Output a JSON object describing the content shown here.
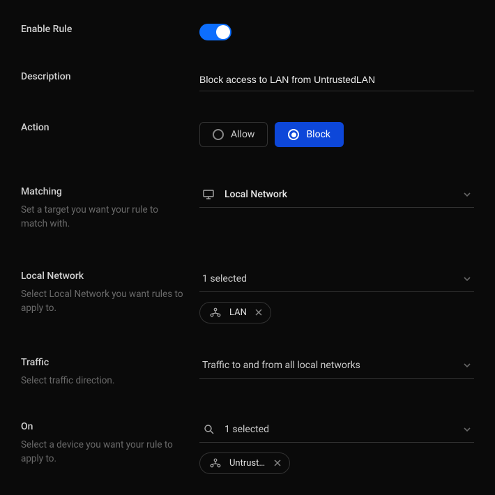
{
  "enable": {
    "label": "Enable Rule",
    "value": true
  },
  "description": {
    "label": "Description",
    "value": "Block access to LAN from UntrustedLAN"
  },
  "action": {
    "label": "Action",
    "options": {
      "allow": "Allow",
      "block": "Block"
    },
    "selected": "block"
  },
  "matching": {
    "label": "Matching",
    "sub": "Set a target you want your rule to match with.",
    "value": "Local Network"
  },
  "local_network": {
    "label": "Local Network",
    "sub": "Select Local Network you want rules to apply to.",
    "summary": "1 selected",
    "chips": [
      "LAN"
    ]
  },
  "traffic": {
    "label": "Traffic",
    "sub": "Select traffic direction.",
    "value": "Traffic to and from all local networks"
  },
  "on": {
    "label": "On",
    "sub": "Select a device you want your rule to apply to.",
    "summary": "1 selected",
    "chips": [
      "Untruste…"
    ]
  }
}
